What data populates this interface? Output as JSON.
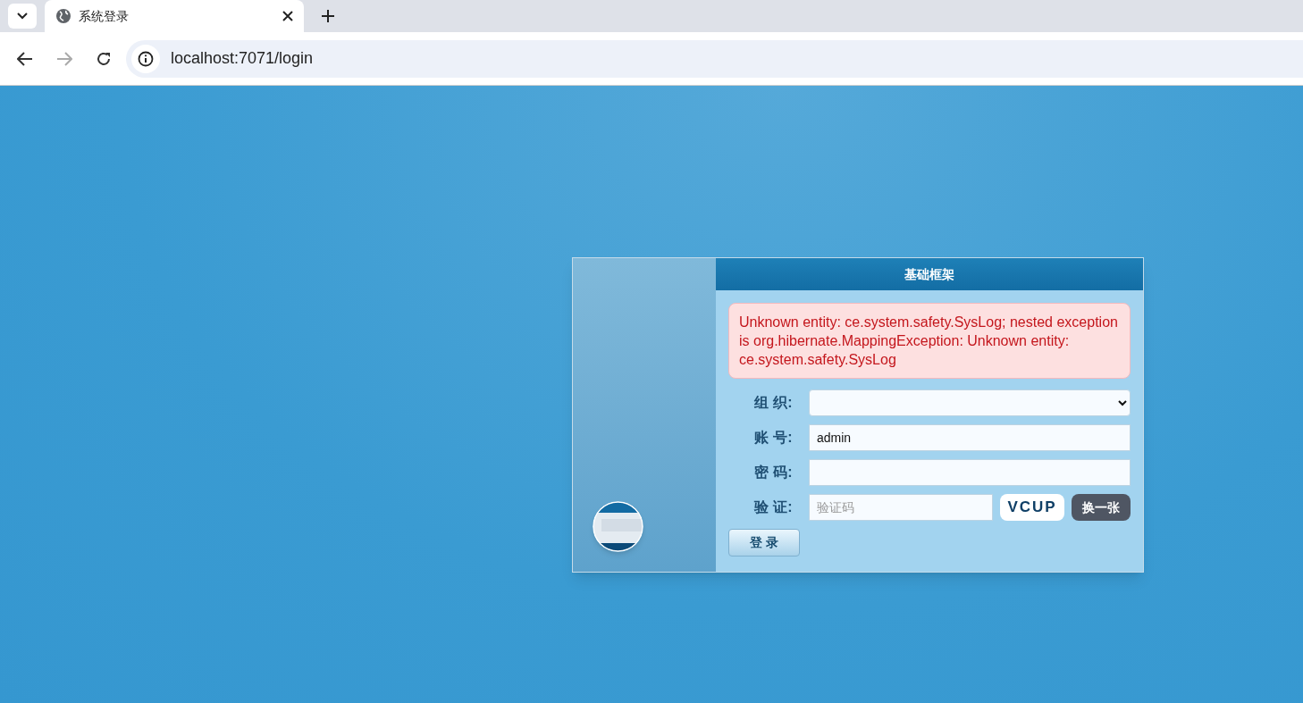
{
  "browser": {
    "tab_title": "系统登录",
    "url": "localhost:7071/login"
  },
  "login": {
    "title": "基础框架",
    "error": "Unknown entity: ce.system.safety.SysLog; nested exception is org.hibernate.MappingException: Unknown entity: ce.system.safety.SysLog",
    "fields": [
      {
        "kind": "select",
        "label": "组 织:"
      },
      {
        "kind": "text",
        "label": "账 号:",
        "value": "admin"
      },
      {
        "kind": "password",
        "label": "密 码:"
      },
      {
        "kind": "captcha",
        "label": "验 证:",
        "placeholder": "验证码",
        "captcha": "VCUP",
        "refresh": "换一张"
      }
    ],
    "submit": "登 录"
  }
}
